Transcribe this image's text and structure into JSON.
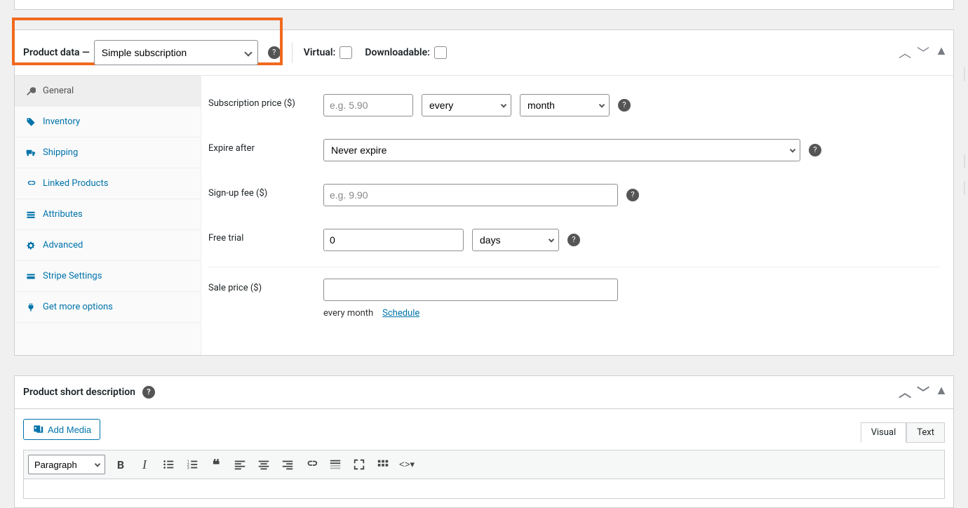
{
  "product_data": {
    "heading_prefix": "Product data —",
    "type_selected": "Simple subscription",
    "virtual_label": "Virtual:",
    "downloadable_label": "Downloadable:"
  },
  "tabs": {
    "general": "General",
    "inventory": "Inventory",
    "shipping": "Shipping",
    "linked": "Linked Products",
    "attributes": "Attributes",
    "advanced": "Advanced",
    "stripe": "Stripe Settings",
    "more": "Get more options"
  },
  "fields": {
    "subscription_price_label": "Subscription price ($)",
    "subscription_price_placeholder": "e.g. 5.90",
    "billing_interval": "every",
    "billing_period": "month",
    "expire_label": "Expire after",
    "expire_value": "Never expire",
    "signup_label": "Sign-up fee ($)",
    "signup_placeholder": "e.g. 9.90",
    "trial_label": "Free trial",
    "trial_value": "0",
    "trial_period": "days",
    "sale_label": "Sale price ($)",
    "sale_note": "every month",
    "schedule": "Schedule"
  },
  "short_desc": {
    "title": "Product short description",
    "add_media": "Add Media",
    "visual": "Visual",
    "text": "Text",
    "para": "Paragraph"
  }
}
